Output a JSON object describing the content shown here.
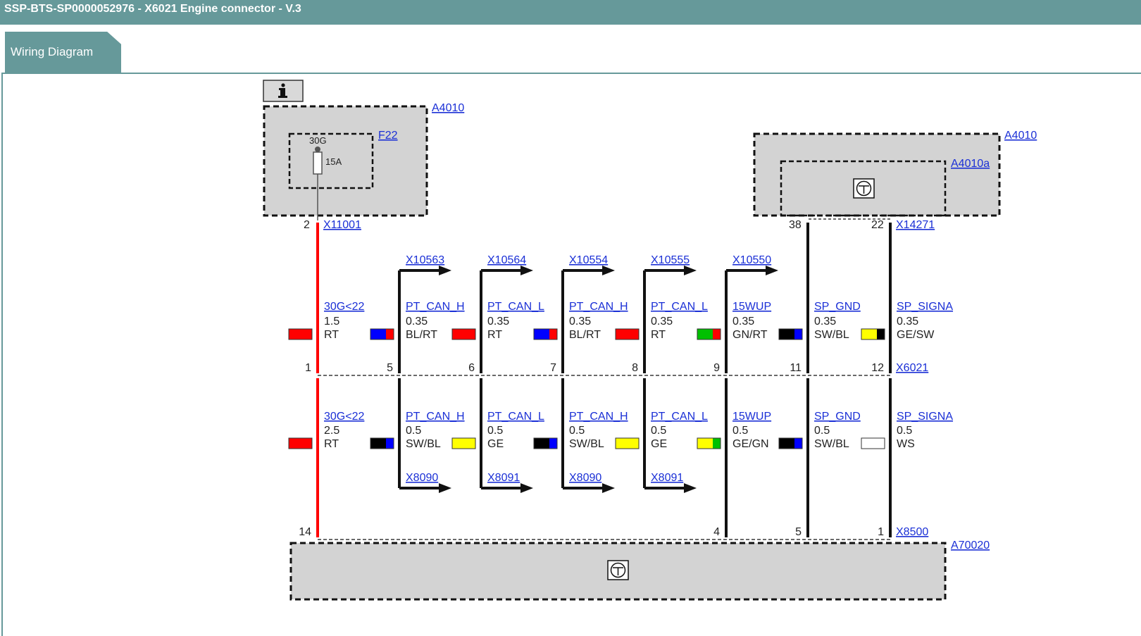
{
  "window": {
    "title": "SSP-BTS-SP0000052976 - X6021 Engine connector - V.3"
  },
  "tabs": [
    {
      "label": "Wiring Diagram",
      "active": true
    }
  ],
  "components": {
    "top_left": {
      "id": "A4010",
      "fuse": {
        "id": "F22",
        "terminal": "30G",
        "rating": "15A"
      },
      "connector": "X11001",
      "pin": "2"
    },
    "top_right": {
      "id": "A4010",
      "sub": "A4010a",
      "connector": "X14271",
      "pin_left": "38",
      "pin_right": "22"
    },
    "bottom": {
      "id": "A70020",
      "connector": "X8500"
    },
    "main_connector": "X6021"
  },
  "wires_upper": [
    {
      "name": "30G<22",
      "size": "1.5",
      "color_label": "RT",
      "colors": [
        "#ff0000"
      ],
      "pin": "1",
      "target": ""
    },
    {
      "name": "PT_CAN_H",
      "size": "0.35",
      "color_label": "BL/RT",
      "colors": [
        "#0000ff",
        "#ff0000"
      ],
      "pin": "5",
      "target": "X10563"
    },
    {
      "name": "PT_CAN_L",
      "size": "0.35",
      "color_label": "RT",
      "colors": [
        "#ff0000"
      ],
      "pin": "6",
      "target": "X10564"
    },
    {
      "name": "PT_CAN_H",
      "size": "0.35",
      "color_label": "BL/RT",
      "colors": [
        "#0000ff",
        "#ff0000"
      ],
      "pin": "7",
      "target": "X10554"
    },
    {
      "name": "PT_CAN_L",
      "size": "0.35",
      "color_label": "RT",
      "colors": [
        "#ff0000"
      ],
      "pin": "8",
      "target": "X10555"
    },
    {
      "name": "15WUP",
      "size": "0.35",
      "color_label": "GN/RT",
      "colors": [
        "#00c000",
        "#ff0000"
      ],
      "pin": "9",
      "target": "X10550"
    },
    {
      "name": "SP_GND",
      "size": "0.35",
      "color_label": "SW/BL",
      "colors": [
        "#000000",
        "#0000ff"
      ],
      "pin": "11",
      "target": ""
    },
    {
      "name": "SP_SIGNA",
      "size": "0.35",
      "color_label": "GE/SW",
      "colors": [
        "#ffff00",
        "#000000"
      ],
      "pin": "12",
      "target": ""
    }
  ],
  "wires_lower": [
    {
      "name": "30G<22",
      "size": "2.5",
      "color_label": "RT",
      "colors": [
        "#ff0000"
      ],
      "pin": "14",
      "target": ""
    },
    {
      "name": "PT_CAN_H",
      "size": "0.5",
      "color_label": "SW/BL",
      "colors": [
        "#000000",
        "#0000ff"
      ],
      "pin": "",
      "target": "X8090"
    },
    {
      "name": "PT_CAN_L",
      "size": "0.5",
      "color_label": "GE",
      "colors": [
        "#ffff00"
      ],
      "pin": "",
      "target": "X8091"
    },
    {
      "name": "PT_CAN_H",
      "size": "0.5",
      "color_label": "SW/BL",
      "colors": [
        "#000000",
        "#0000ff"
      ],
      "pin": "",
      "target": "X8090"
    },
    {
      "name": "PT_CAN_L",
      "size": "0.5",
      "color_label": "GE",
      "colors": [
        "#ffff00"
      ],
      "pin": "",
      "target": "X8091"
    },
    {
      "name": "15WUP",
      "size": "0.5",
      "color_label": "GE/GN",
      "colors": [
        "#ffff00",
        "#00c000"
      ],
      "pin": "4",
      "target": ""
    },
    {
      "name": "SP_GND",
      "size": "0.5",
      "color_label": "SW/BL",
      "colors": [
        "#000000",
        "#0000ff"
      ],
      "pin": "5",
      "target": ""
    },
    {
      "name": "SP_SIGNA",
      "size": "0.5",
      "color_label": "WS",
      "colors": [
        "#ffffff"
      ],
      "pin": "1",
      "target": ""
    }
  ],
  "icons": {
    "info": "info-icon",
    "ground": "ground-symbol-icon"
  }
}
